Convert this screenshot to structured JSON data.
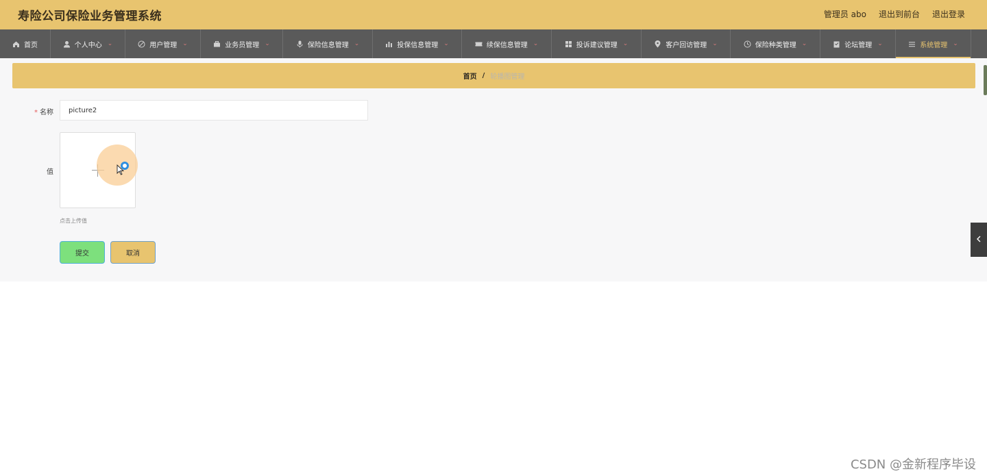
{
  "header": {
    "title": "寿险公司保险业务管理系统",
    "user": "管理员 abo",
    "to_front": "退出到前台",
    "logout": "退出登录"
  },
  "nav": {
    "items": [
      {
        "label": "首页",
        "icon": "home-icon",
        "has_dropdown": false
      },
      {
        "label": "个人中心",
        "icon": "user-icon",
        "has_dropdown": true
      },
      {
        "label": "用户管理",
        "icon": "compass-icon",
        "has_dropdown": true
      },
      {
        "label": "业务员管理",
        "icon": "briefcase-icon",
        "has_dropdown": true
      },
      {
        "label": "保险信息管理",
        "icon": "microphone-icon",
        "has_dropdown": true
      },
      {
        "label": "投保信息管理",
        "icon": "bar-chart-icon",
        "has_dropdown": true
      },
      {
        "label": "续保信息管理",
        "icon": "ticket-icon",
        "has_dropdown": true
      },
      {
        "label": "投诉建议管理",
        "icon": "grid-icon",
        "has_dropdown": true
      },
      {
        "label": "客户回访管理",
        "icon": "location-icon",
        "has_dropdown": true
      },
      {
        "label": "保险种类管理",
        "icon": "clock-icon",
        "has_dropdown": true
      },
      {
        "label": "论坛管理",
        "icon": "clipboard-icon",
        "has_dropdown": true
      },
      {
        "label": "系统管理",
        "icon": "list-icon",
        "has_dropdown": true,
        "active": true
      }
    ],
    "active_color": "#e8c46f"
  },
  "breadcrumb": {
    "home": "首页",
    "separator": "/",
    "current": "轮播图管理"
  },
  "form": {
    "name_label": "名称",
    "name_required": "*",
    "name_value": "picture2",
    "value_label": "值",
    "upload_hint": "点击上传值",
    "submit_label": "提交",
    "cancel_label": "取消"
  },
  "watermark": "CSDN @金新程序毕设",
  "colors": {
    "accent": "#e8c46f",
    "nav_bg": "#5a5a5a",
    "submit": "#7de07d"
  }
}
